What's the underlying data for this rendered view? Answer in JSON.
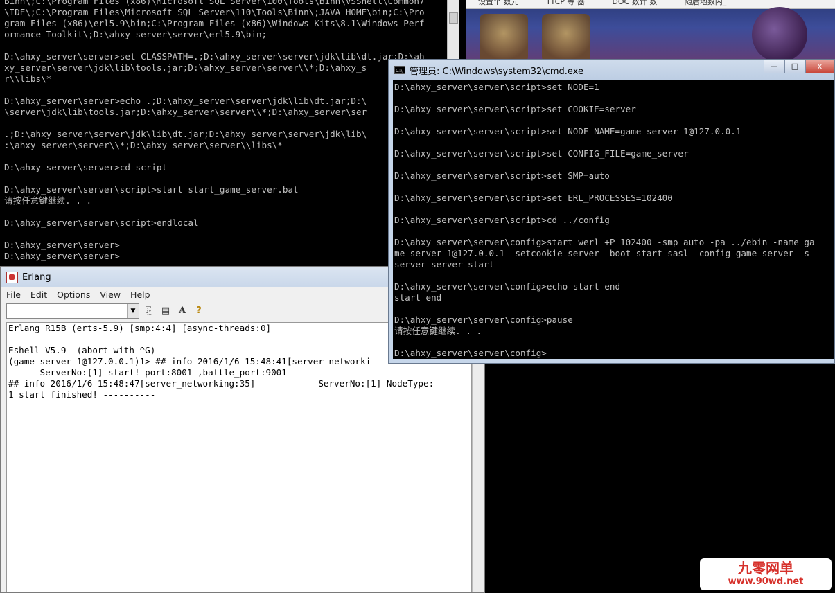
{
  "desktop_bar": [
    "设置个 数元",
    "TTCP 等  器",
    "DOC 数计 数",
    "随后地数内_"
  ],
  "back_cmd": {
    "lines": [
      "Binn\\;C:\\Program Files (x86)\\Microsoft SQL Server\\100\\Tools\\Binn\\VSShell\\Common7",
      "\\IDE\\;C:\\Program Files\\Microsoft SQL Server\\110\\Tools\\Binn\\;JAVA_HOME\\bin;C:\\Pro",
      "gram Files (x86)\\erl5.9\\bin;C:\\Program Files (x86)\\Windows Kits\\8.1\\Windows Perf",
      "ormance Toolkit\\;D:\\ahxy_server\\server\\erl5.9\\bin;",
      "",
      "D:\\ahxy_server\\server>set CLASSPATH=.;D:\\ahxy_server\\server\\jdk\\lib\\dt.jar;D:\\ah",
      "xy_server\\server\\jdk\\lib\\tools.jar;D:\\ahxy_server\\server\\\\*;D:\\ahxy_s",
      "r\\\\libs\\*",
      "",
      "D:\\ahxy_server\\server>echo .;D:\\ahxy_server\\server\\jdk\\lib\\dt.jar;D:\\",
      "\\server\\jdk\\lib\\tools.jar;D:\\ahxy_server\\server\\\\*;D:\\ahxy_server\\ser",
      "",
      ".;D:\\ahxy_server\\server\\jdk\\lib\\dt.jar;D:\\ahxy_server\\server\\jdk\\lib\\",
      ":\\ahxy_server\\server\\\\*;D:\\ahxy_server\\server\\\\libs\\*",
      "",
      "D:\\ahxy_server\\server>cd script",
      "",
      "D:\\ahxy_server\\server\\script>start start_game_server.bat",
      "请按任意键继续. . .",
      "",
      "D:\\ahxy_server\\server\\script>endlocal",
      "",
      "D:\\ahxy_server\\server>",
      "D:\\ahxy_server\\server>"
    ]
  },
  "erlang": {
    "title": "Erlang",
    "menu": [
      "File",
      "Edit",
      "Options",
      "View",
      "Help"
    ],
    "toolbar_icons": [
      "copy-icon",
      "paste-icon",
      "font-icon",
      "help-icon"
    ],
    "lines": [
      "Erlang R15B (erts-5.9) [smp:4:4] [async-threads:0]",
      "",
      "Eshell V5.9  (abort with ^G)",
      "(game_server_1@127.0.0.1)1> ## info 2016/1/6 15:48:41[server_networki",
      "----- ServerNo:[1] start! port:8001 ,battle_port:9001----------",
      "## info 2016/1/6 15:48:47[server_networking:35] ---------- ServerNo:[1] NodeType:",
      "1 start finished! ----------"
    ]
  },
  "front_cmd": {
    "title": "管理员: C:\\Windows\\system32\\cmd.exe",
    "buttons": {
      "minimize": "—",
      "maximize": "□",
      "close": "x"
    },
    "lines": [
      "D:\\ahxy_server\\server\\script>set NODE=1",
      "",
      "D:\\ahxy_server\\server\\script>set COOKIE=server",
      "",
      "D:\\ahxy_server\\server\\script>set NODE_NAME=game_server_1@127.0.0.1",
      "",
      "D:\\ahxy_server\\server\\script>set CONFIG_FILE=game_server",
      "",
      "D:\\ahxy_server\\server\\script>set SMP=auto",
      "",
      "D:\\ahxy_server\\server\\script>set ERL_PROCESSES=102400",
      "",
      "D:\\ahxy_server\\server\\script>cd ../config",
      "",
      "D:\\ahxy_server\\server\\config>start werl +P 102400 -smp auto -pa ../ebin -name ga",
      "me_server_1@127.0.0.1 -setcookie server -boot start_sasl -config game_server -s",
      "server server_start",
      "",
      "D:\\ahxy_server\\server\\config>echo start end",
      "start end",
      "",
      "D:\\ahxy_server\\server\\config>pause",
      "请按任意键继续. . .",
      "",
      "D:\\ahxy_server\\server\\config>"
    ]
  },
  "watermark": {
    "line1": "九零网单",
    "line2": "www.90wd.net"
  }
}
